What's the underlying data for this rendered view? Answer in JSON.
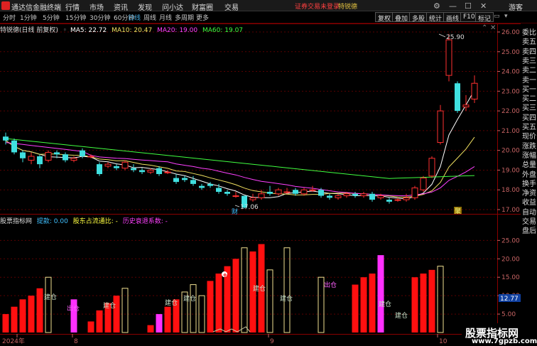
{
  "titlebar": {
    "app_name": "通达信金融终端",
    "menus": [
      "行情",
      "市场",
      "资讯",
      "发现",
      "问小达",
      "财富圈",
      "交易"
    ],
    "status_login": "证券交易未登录",
    "status_stock": "特锐德",
    "guest": "游客"
  },
  "toolbar": {
    "periods": [
      "分时",
      "1分钟",
      "5分钟",
      "15分钟",
      "30分钟",
      "60分钟",
      "日线",
      "周线",
      "月线",
      "多周期",
      "更多"
    ],
    "active_period": "日线",
    "buttons": [
      "复权",
      "叠加",
      "多股",
      "统计",
      "画线",
      "F10",
      "标记"
    ]
  },
  "main_chart": {
    "title": "特锐德(日线 前复权)",
    "ma": [
      {
        "label": "MA5: 22.72",
        "color": "#ffffff"
      },
      {
        "label": "MA10: 20.47",
        "color": "#f0e060"
      },
      {
        "label": "MA20: 19.00",
        "color": "#ff40ff"
      },
      {
        "label": "MA60: 19.07",
        "color": "#40ff40"
      }
    ],
    "y_ticks": [
      "26.00",
      "25.00",
      "24.00",
      "23.00",
      "22.00",
      "21.00",
      "20.00",
      "19.00",
      "18.00",
      "17.00"
    ],
    "high_label": "25.90",
    "low_label": "17.06",
    "marker_cai": "财",
    "marker_ju": "聚"
  },
  "indicator": {
    "title": "股票指标网",
    "items": [
      {
        "label": "提款: 0.00",
        "color": "#40c0ff"
      },
      {
        "label": "股东占流通比: -",
        "color": "#ffff40"
      },
      {
        "label": "历史衰退系数: -",
        "color": "#ff40ff"
      }
    ],
    "y_ticks": [
      "25.00",
      "20.00",
      "15.00",
      "10.00",
      "5.00"
    ],
    "current_value": "12.77",
    "annot_jiancang": "建仓",
    "annot_chucang": "出仓"
  },
  "x_axis": {
    "labels": [
      "2024年",
      "8",
      "9",
      "10"
    ]
  },
  "right_panel": {
    "items": [
      "委比",
      "卖五",
      "卖四",
      "卖三",
      "卖二",
      "卖一",
      "买一",
      "买二",
      "买三",
      "买四",
      "买五",
      "现价",
      "涨跌",
      "涨幅",
      "总量",
      "外盘",
      "换手",
      "净资",
      "收益",
      "自动",
      "交易",
      "盘后"
    ]
  },
  "watermark": {
    "title": "股票指标网",
    "url": "www.7gpzb.com"
  },
  "chart_data": {
    "type": "candlestick",
    "title": "特锐德(日线 前复权)",
    "y_range": [
      16.8,
      26.3
    ],
    "candles": [
      {
        "o": 20.7,
        "c": 20.5,
        "h": 20.9,
        "l": 20.3
      },
      {
        "o": 20.5,
        "c": 19.9,
        "h": 20.6,
        "l": 19.8
      },
      {
        "o": 19.9,
        "c": 19.6,
        "h": 20.0,
        "l": 19.4
      },
      {
        "o": 19.5,
        "c": 19.7,
        "h": 19.9,
        "l": 19.3
      },
      {
        "o": 19.7,
        "c": 19.3,
        "h": 19.8,
        "l": 19.1
      },
      {
        "o": 19.5,
        "c": 19.9,
        "h": 20.0,
        "l": 19.4
      },
      {
        "o": 19.9,
        "c": 19.8,
        "h": 20.0,
        "l": 19.6
      },
      {
        "o": 19.8,
        "c": 19.5,
        "h": 19.9,
        "l": 19.4
      },
      {
        "o": 19.5,
        "c": 19.6,
        "h": 19.7,
        "l": 19.4
      },
      {
        "o": 20.0,
        "c": 19.7,
        "h": 20.1,
        "l": 19.6
      },
      {
        "o": 19.7,
        "c": 19.7,
        "h": 19.8,
        "l": 19.6
      },
      {
        "o": 19.3,
        "c": 18.8,
        "h": 19.4,
        "l": 18.7
      },
      {
        "o": 19.2,
        "c": 19.3,
        "h": 19.4,
        "l": 19.1
      },
      {
        "o": 19.2,
        "c": 19.1,
        "h": 19.3,
        "l": 19.0
      },
      {
        "o": 19.1,
        "c": 19.4,
        "h": 19.5,
        "l": 19.0
      },
      {
        "o": 19.1,
        "c": 19.0,
        "h": 19.3,
        "l": 18.9
      },
      {
        "o": 19.0,
        "c": 18.9,
        "h": 19.1,
        "l": 18.8
      },
      {
        "o": 18.9,
        "c": 19.0,
        "h": 19.1,
        "l": 18.8
      },
      {
        "o": 19.1,
        "c": 18.8,
        "h": 19.2,
        "l": 18.7
      },
      {
        "o": 18.9,
        "c": 18.9,
        "h": 19.0,
        "l": 18.8
      },
      {
        "o": 18.6,
        "c": 18.4,
        "h": 18.8,
        "l": 18.3
      },
      {
        "o": 18.6,
        "c": 18.5,
        "h": 18.7,
        "l": 18.4
      },
      {
        "o": 18.5,
        "c": 18.3,
        "h": 18.7,
        "l": 18.2
      },
      {
        "o": 18.2,
        "c": 18.1,
        "h": 18.3,
        "l": 18.0
      },
      {
        "o": 18.3,
        "c": 18.2,
        "h": 18.4,
        "l": 18.1
      },
      {
        "o": 18.1,
        "c": 17.9,
        "h": 18.3,
        "l": 17.8
      },
      {
        "o": 17.9,
        "c": 17.8,
        "h": 18.0,
        "l": 17.7
      },
      {
        "o": 17.7,
        "c": 17.7,
        "h": 17.9,
        "l": 17.6
      },
      {
        "o": 17.7,
        "c": 17.1,
        "h": 17.7,
        "l": 17.06
      },
      {
        "o": 17.5,
        "c": 17.6,
        "h": 17.8,
        "l": 17.4
      },
      {
        "o": 17.6,
        "c": 17.8,
        "h": 18.0,
        "l": 17.5
      },
      {
        "o": 17.9,
        "c": 17.8,
        "h": 18.2,
        "l": 17.7
      },
      {
        "o": 17.8,
        "c": 18.0,
        "h": 18.1,
        "l": 17.7
      },
      {
        "o": 17.9,
        "c": 17.9,
        "h": 18.1,
        "l": 17.8
      },
      {
        "o": 18.0,
        "c": 17.8,
        "h": 18.1,
        "l": 17.7
      },
      {
        "o": 17.8,
        "c": 18.0,
        "h": 18.1,
        "l": 17.7
      },
      {
        "o": 18.0,
        "c": 18.0,
        "h": 18.2,
        "l": 17.9
      },
      {
        "o": 18.0,
        "c": 17.7,
        "h": 18.1,
        "l": 17.6
      },
      {
        "o": 17.7,
        "c": 17.6,
        "h": 17.8,
        "l": 17.5
      },
      {
        "o": 17.6,
        "c": 17.7,
        "h": 17.8,
        "l": 17.5
      },
      {
        "o": 17.7,
        "c": 17.8,
        "h": 17.9,
        "l": 17.6
      },
      {
        "o": 17.8,
        "c": 17.7,
        "h": 17.9,
        "l": 17.6
      },
      {
        "o": 17.7,
        "c": 17.8,
        "h": 17.9,
        "l": 17.6
      },
      {
        "o": 17.8,
        "c": 17.5,
        "h": 17.9,
        "l": 17.4
      },
      {
        "o": 17.6,
        "c": 17.7,
        "h": 17.8,
        "l": 17.5
      },
      {
        "o": 17.5,
        "c": 17.4,
        "h": 17.6,
        "l": 17.3
      },
      {
        "o": 17.5,
        "c": 17.5,
        "h": 17.6,
        "l": 17.4
      },
      {
        "o": 17.5,
        "c": 17.6,
        "h": 17.8,
        "l": 17.4
      },
      {
        "o": 17.6,
        "c": 18.1,
        "h": 18.2,
        "l": 17.5
      },
      {
        "o": 18.0,
        "c": 18.6,
        "h": 18.7,
        "l": 17.9
      },
      {
        "o": 18.7,
        "c": 19.6,
        "h": 19.7,
        "l": 18.6
      },
      {
        "o": 20.4,
        "c": 22.0,
        "h": 22.3,
        "l": 20.3
      },
      {
        "o": 23.8,
        "c": 25.6,
        "h": 25.9,
        "l": 23.5
      },
      {
        "o": 23.4,
        "c": 22.0,
        "h": 23.5,
        "l": 21.9
      },
      {
        "o": 22.2,
        "c": 22.3,
        "h": 22.8,
        "l": 22.0
      },
      {
        "o": 22.6,
        "c": 23.4,
        "h": 23.8,
        "l": 22.4
      }
    ],
    "ma_series": [
      {
        "name": "MA5",
        "color": "#ffffff"
      },
      {
        "name": "MA10",
        "color": "#f0e060"
      },
      {
        "name": "MA20",
        "color": "#ff40ff"
      },
      {
        "name": "MA60",
        "color": "#40ff40"
      }
    ],
    "indicator_bars": [
      {
        "v": 5,
        "c": "red"
      },
      {
        "v": 7,
        "c": "red"
      },
      {
        "v": 9,
        "c": "red"
      },
      {
        "v": 10,
        "c": "red"
      },
      {
        "v": 12,
        "c": "red"
      },
      {
        "v": 15,
        "c": "yellow"
      },
      {
        "v": 0,
        "c": "none"
      },
      {
        "v": 0,
        "c": "none"
      },
      {
        "v": 9,
        "c": "magenta"
      },
      {
        "v": 0,
        "c": "none"
      },
      {
        "v": 3,
        "c": "red"
      },
      {
        "v": 6,
        "c": "red"
      },
      {
        "v": 8,
        "c": "red"
      },
      {
        "v": 10,
        "c": "red"
      },
      {
        "v": 12,
        "c": "yellow"
      },
      {
        "v": 0,
        "c": "none"
      },
      {
        "v": 0,
        "c": "none"
      },
      {
        "v": 2,
        "c": "red"
      },
      {
        "v": 5,
        "c": "magenta"
      },
      {
        "v": 7,
        "c": "red"
      },
      {
        "v": 9,
        "c": "red"
      },
      {
        "v": 11,
        "c": "yellow"
      },
      {
        "v": 13,
        "c": "yellow"
      },
      {
        "v": 10,
        "c": "yellow"
      },
      {
        "v": 14,
        "c": "red"
      },
      {
        "v": 16,
        "c": "red"
      },
      {
        "v": 18,
        "c": "red"
      },
      {
        "v": 20,
        "c": "red"
      },
      {
        "v": 23,
        "c": "yellow"
      },
      {
        "v": 22,
        "c": "red"
      },
      {
        "v": 24,
        "c": "red"
      },
      {
        "v": 17,
        "c": "yellow"
      },
      {
        "v": 0,
        "c": "none"
      },
      {
        "v": 23,
        "c": "yellow"
      },
      {
        "v": 0,
        "c": "none"
      },
      {
        "v": 0,
        "c": "none"
      },
      {
        "v": 0,
        "c": "none"
      },
      {
        "v": 15,
        "c": "yellow"
      },
      {
        "v": 0,
        "c": "none"
      },
      {
        "v": 0,
        "c": "none"
      },
      {
        "v": 0,
        "c": "none"
      },
      {
        "v": 13,
        "c": "red"
      },
      {
        "v": 15,
        "c": "red"
      },
      {
        "v": 16,
        "c": "red"
      },
      {
        "v": 21,
        "c": "magenta"
      },
      {
        "v": 0,
        "c": "none"
      },
      {
        "v": 0,
        "c": "none"
      },
      {
        "v": 0,
        "c": "none"
      },
      {
        "v": 15,
        "c": "red"
      },
      {
        "v": 16,
        "c": "red"
      },
      {
        "v": 17,
        "c": "red"
      },
      {
        "v": 18,
        "c": "yellow"
      },
      {
        "v": 0,
        "c": "none"
      },
      {
        "v": 0,
        "c": "none"
      },
      {
        "v": 0,
        "c": "none"
      },
      {
        "v": 0,
        "c": "none"
      }
    ],
    "indicator_y_range": [
      0,
      27
    ]
  }
}
